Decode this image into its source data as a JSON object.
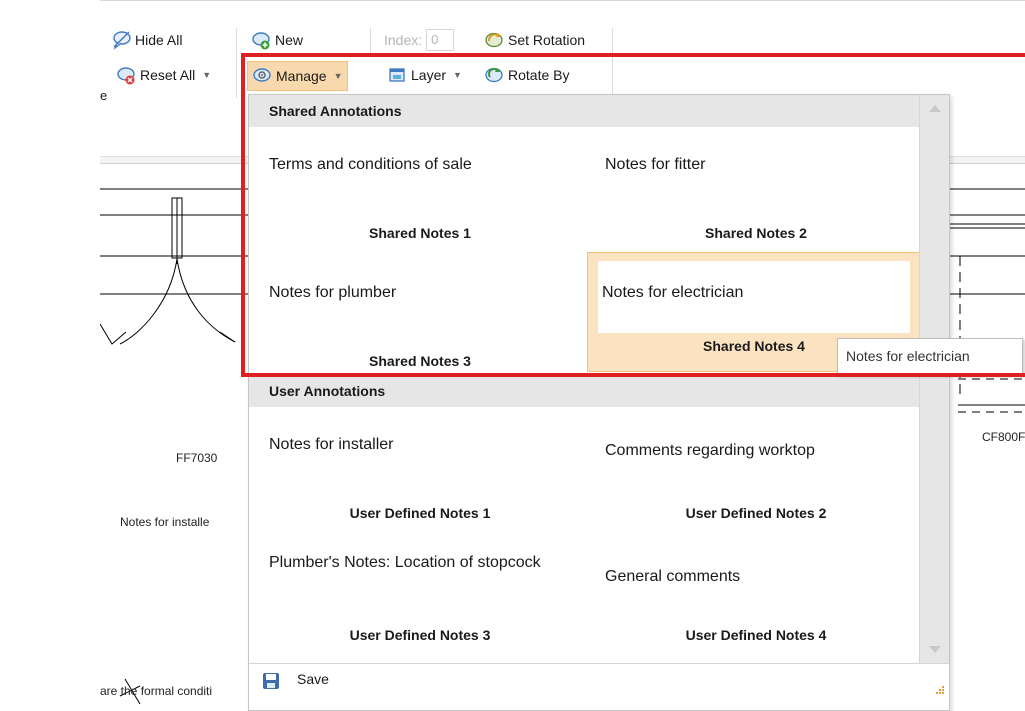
{
  "ribbon": {
    "hide_all": "Hide All",
    "reset_all": "Reset All",
    "new": "New",
    "index_label": "Index:",
    "index_value": "0",
    "set_rotation": "Set Rotation",
    "manage": "Manage",
    "layer": "Layer",
    "rotate_by": "Rotate By",
    "cut_label": "e"
  },
  "canvas": {
    "label_ff7030": "FF7030",
    "label_cf800": "CF800F",
    "label_notes_installer": "Notes for installe",
    "label_formal": "are the formal conditi"
  },
  "dropdown": {
    "shared_header": "Shared Annotations",
    "user_header": "User Annotations",
    "shared": [
      {
        "title": "Terms and conditions of sale",
        "name": "Shared Notes 1"
      },
      {
        "title": "Notes for fitter",
        "name": "Shared Notes 2"
      },
      {
        "title": "Notes for plumber",
        "name": "Shared Notes 3"
      },
      {
        "title": "Notes for electrician",
        "name": "Shared Notes 4"
      }
    ],
    "user": [
      {
        "title": "Notes for installer",
        "name": "User Defined Notes 1"
      },
      {
        "title": "Comments regarding worktop",
        "name": "User Defined Notes 2"
      },
      {
        "title": "Plumber's Notes: Location of stopcock",
        "name": "User Defined Notes 3"
      },
      {
        "title": "General comments",
        "name": "User Defined Notes 4"
      }
    ],
    "save": "Save"
  },
  "tooltip": "Notes for electrician",
  "colors": {
    "hover_bg": "#fbe3c2",
    "hover_border": "#f1c27d",
    "highlight": "#e02020",
    "section_bg": "#e6e6e6"
  },
  "icons": {
    "hide_all": "speech-bubble-icon",
    "reset_all": "speech-bubble-reset-icon",
    "new": "speech-bubble-add-icon",
    "set_rotation": "rotation-icon",
    "manage": "manage-gear-icon",
    "layer": "layer-icon",
    "rotate_by": "rotate-arrow-icon",
    "save": "floppy-disk-icon"
  }
}
